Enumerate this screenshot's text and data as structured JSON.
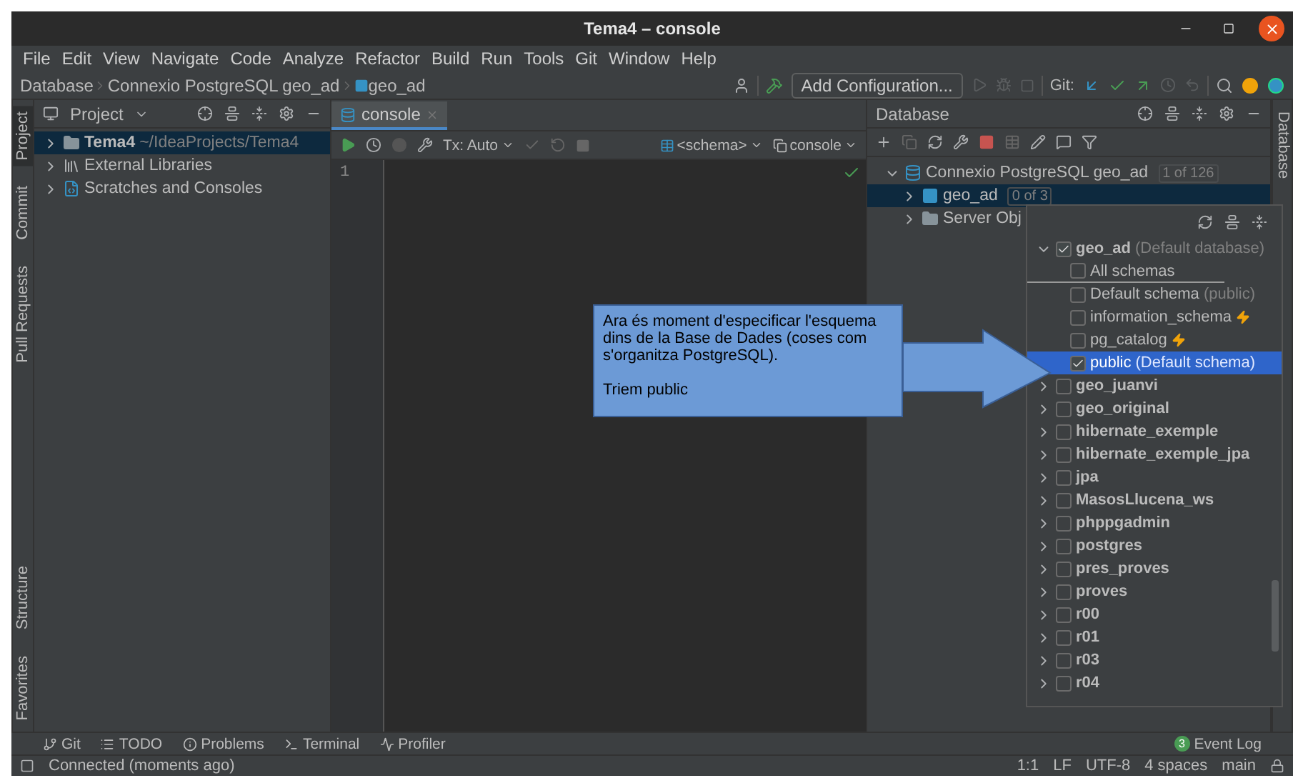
{
  "window": {
    "title": "Tema4 – console"
  },
  "menu": [
    "File",
    "Edit",
    "View",
    "Navigate",
    "Code",
    "Analyze",
    "Refactor",
    "Build",
    "Run",
    "Tools",
    "Git",
    "Window",
    "Help"
  ],
  "breadcrumbs": [
    "Database",
    "Connexio PostgreSQL geo_ad",
    "geo_ad"
  ],
  "toolbar": {
    "run_config": "Add Configuration...",
    "git_label": "Git:"
  },
  "left_stripe": {
    "top": [
      {
        "label": "Project",
        "selected": true
      },
      {
        "label": "Commit",
        "selected": false
      },
      {
        "label": "Pull Requests",
        "selected": false
      }
    ],
    "bottom": [
      {
        "label": "Structure",
        "selected": false
      },
      {
        "label": "Favorites",
        "selected": false
      }
    ]
  },
  "project": {
    "title": "Project",
    "items": [
      {
        "label": "Tema4",
        "path": "~/IdeaProjects/Tema4",
        "kind": "module",
        "selected": true
      },
      {
        "label": "External Libraries",
        "kind": "library",
        "selected": false
      },
      {
        "label": "Scratches and Consoles",
        "kind": "scratch",
        "selected": false
      }
    ]
  },
  "editor": {
    "tabs": [
      {
        "label": "console",
        "selected": true
      }
    ],
    "tx": "Tx: Auto",
    "schema": "<schema>",
    "session": "console",
    "line_numbers": [
      "1"
    ]
  },
  "database": {
    "title": "Database",
    "tree": [
      {
        "label": "Connexio PostgreSQL geo_ad",
        "badge": "1 of 126",
        "kind": "datasource",
        "expanded": true,
        "selected": false,
        "children": [
          {
            "label": "geo_ad",
            "badge": "0 of 3",
            "kind": "database",
            "expanded": false,
            "selected": true
          },
          {
            "label": "Server Obj",
            "kind": "folder",
            "expanded": false,
            "selected": false
          }
        ]
      }
    ]
  },
  "right_stripe": [
    {
      "label": "Database",
      "selected": false
    }
  ],
  "schema_popup": {
    "items": [
      {
        "kind": "database",
        "label": "geo_ad",
        "note": "(Default database)",
        "checked": true,
        "selected": false,
        "expanded": true,
        "flash": false
      },
      {
        "kind": "all",
        "label": "All schemas",
        "checked": false,
        "selected": false,
        "flash": false
      },
      {
        "kind": "schema",
        "label": "Default schema",
        "note": "(public)",
        "checked": false,
        "selected": false,
        "flash": false
      },
      {
        "kind": "schema",
        "label": "information_schema",
        "checked": false,
        "selected": false,
        "flash": true
      },
      {
        "kind": "schema",
        "label": "pg_catalog",
        "checked": false,
        "selected": false,
        "flash": true
      },
      {
        "kind": "schema",
        "label": "public",
        "note": "(Default schema)",
        "checked": true,
        "selected": true,
        "flash": false
      },
      {
        "kind": "database",
        "label": "geo_juanvi",
        "checked": false,
        "selected": false,
        "expanded": false,
        "flash": false
      },
      {
        "kind": "database",
        "label": "geo_original",
        "checked": false,
        "selected": false,
        "expanded": false,
        "flash": false
      },
      {
        "kind": "database",
        "label": "hibernate_exemple",
        "checked": false,
        "selected": false,
        "expanded": false,
        "flash": false
      },
      {
        "kind": "database",
        "label": "hibernate_exemple_jpa",
        "checked": false,
        "selected": false,
        "expanded": false,
        "flash": false
      },
      {
        "kind": "database",
        "label": "jpa",
        "checked": false,
        "selected": false,
        "expanded": false,
        "flash": false
      },
      {
        "kind": "database",
        "label": "MasosLlucena_ws",
        "checked": false,
        "selected": false,
        "expanded": false,
        "flash": false
      },
      {
        "kind": "database",
        "label": "phppgadmin",
        "checked": false,
        "selected": false,
        "expanded": false,
        "flash": false
      },
      {
        "kind": "database",
        "label": "postgres",
        "checked": false,
        "selected": false,
        "expanded": false,
        "flash": false
      },
      {
        "kind": "database",
        "label": "pres_proves",
        "checked": false,
        "selected": false,
        "expanded": false,
        "flash": false
      },
      {
        "kind": "database",
        "label": "proves",
        "checked": false,
        "selected": false,
        "expanded": false,
        "flash": false
      },
      {
        "kind": "database",
        "label": "r00",
        "checked": false,
        "selected": false,
        "expanded": false,
        "flash": false
      },
      {
        "kind": "database",
        "label": "r01",
        "checked": false,
        "selected": false,
        "expanded": false,
        "flash": false
      },
      {
        "kind": "database",
        "label": "r03",
        "checked": false,
        "selected": false,
        "expanded": false,
        "flash": false
      },
      {
        "kind": "database",
        "label": "r04",
        "checked": false,
        "selected": false,
        "expanded": false,
        "flash": false
      }
    ]
  },
  "callout": {
    "paragraphs": [
      "Ara és moment d'especificar l'esquema dins de la Base de Dades (coses com s'organitza PostgreSQL).",
      "Triem public"
    ]
  },
  "tool_tabs": [
    {
      "label": "Git",
      "kind": "git"
    },
    {
      "label": "TODO",
      "kind": "todo"
    },
    {
      "label": "Problems",
      "kind": "problems"
    },
    {
      "label": "Terminal",
      "kind": "terminal"
    },
    {
      "label": "Profiler",
      "kind": "profiler"
    }
  ],
  "event_log": {
    "label": "Event Log",
    "count": "3"
  },
  "status_bar": {
    "message": "Connected (moments ago)",
    "position": "1:1",
    "line_separator": "LF",
    "encoding": "UTF-8",
    "indent": "4 spaces",
    "branch": "main"
  }
}
